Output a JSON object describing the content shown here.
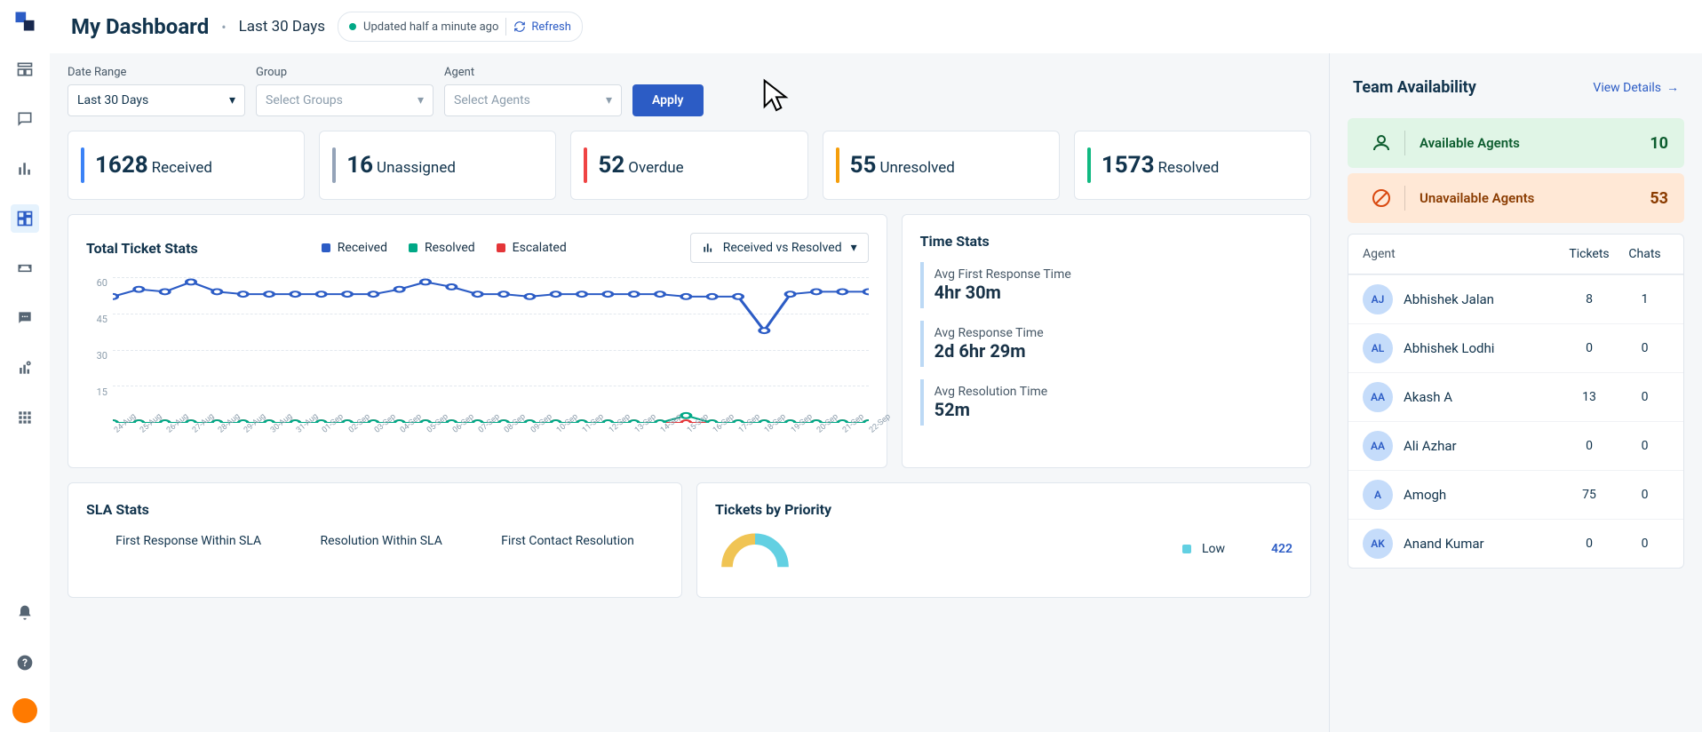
{
  "page": {
    "title": "My Dashboard",
    "date_range": "Last 30 Days",
    "status": "Updated half a minute ago",
    "refresh": "Refresh"
  },
  "filters": {
    "date": {
      "label": "Date Range",
      "value": "Last 30 Days"
    },
    "group": {
      "label": "Group",
      "placeholder": "Select Groups"
    },
    "agent": {
      "label": "Agent",
      "placeholder": "Select Agents"
    },
    "apply": "Apply"
  },
  "kpis": [
    {
      "value": "1628",
      "label": "Received",
      "color": "#3b82f6"
    },
    {
      "value": "16",
      "label": "Unassigned",
      "color": "#94a3b8"
    },
    {
      "value": "52",
      "label": "Overdue",
      "color": "#ef4444"
    },
    {
      "value": "55",
      "label": "Unresolved",
      "color": "#f59e0b"
    },
    {
      "value": "1573",
      "label": "Resolved",
      "color": "#10b981"
    }
  ],
  "ticket_stats": {
    "title": "Total Ticket Stats",
    "selector": "Received vs Resolved",
    "legend": [
      {
        "label": "Received",
        "color": "#2c5cc5"
      },
      {
        "label": "Resolved",
        "color": "#00a886"
      },
      {
        "label": "Escalated",
        "color": "#e43538"
      }
    ]
  },
  "chart_data": {
    "type": "line",
    "title": "Total Ticket Stats",
    "xlabel": "",
    "ylabel": "",
    "ylim": [
      0,
      60
    ],
    "y_ticks": [
      60,
      45,
      30,
      15,
      ""
    ],
    "categories": [
      "24-Aug",
      "25-Aug",
      "26-Aug",
      "27-Aug",
      "28-Aug",
      "29-Aug",
      "30-Aug",
      "31-Aug",
      "01-Sep",
      "02-Sep",
      "03-Sep",
      "04-Sep",
      "05-Sep",
      "06-Sep",
      "07-Sep",
      "08-Sep",
      "09-Sep",
      "10-Sep",
      "11-Sep",
      "12-Sep",
      "13-Sep",
      "14-Sep",
      "15-Sep",
      "16-Sep",
      "17-Sep",
      "18-Sep",
      "19-Sep",
      "20-Sep",
      "21-Sep",
      "22-Sep"
    ],
    "series": [
      {
        "name": "Received",
        "color": "#2c5cc5",
        "values": [
          52,
          55,
          54,
          58,
          54,
          53,
          53,
          53,
          53,
          53,
          53,
          55,
          58,
          56,
          53,
          53,
          52,
          53,
          53,
          53,
          53,
          53,
          52,
          52,
          52,
          38,
          53,
          54,
          54,
          54
        ]
      },
      {
        "name": "Resolved",
        "color": "#00a886",
        "values": [
          0,
          0,
          0,
          0,
          0,
          0,
          0,
          0,
          0,
          0,
          0,
          0,
          0,
          0,
          0,
          0,
          0,
          0,
          0,
          0,
          0,
          0,
          3,
          0,
          0,
          0,
          0,
          0,
          0,
          0
        ]
      },
      {
        "name": "Escalated",
        "color": "#e43538",
        "values": [
          0,
          0,
          0,
          0,
          0,
          0,
          0,
          0,
          0,
          0,
          0,
          0,
          0,
          0,
          0,
          0,
          0,
          0,
          0,
          0,
          0,
          0,
          0,
          0,
          0,
          0,
          0,
          0,
          0,
          0
        ]
      }
    ]
  },
  "time_stats": {
    "title": "Time Stats",
    "items": [
      {
        "label": "Avg First Response Time",
        "value": "4hr 30m"
      },
      {
        "label": "Avg Response Time",
        "value": "2d 6hr 29m"
      },
      {
        "label": "Avg Resolution Time",
        "value": "52m"
      }
    ]
  },
  "sla": {
    "title": "SLA Stats",
    "cols": [
      "First Response Within SLA",
      "Resolution Within SLA",
      "First Contact Resolution"
    ]
  },
  "priority": {
    "title": "Tickets by Priority",
    "items": [
      {
        "label": "Low",
        "value": "422",
        "color": "#62d0e2"
      }
    ]
  },
  "team": {
    "title": "Team Availability",
    "view_link": "View Details",
    "available": {
      "label": "Available Agents",
      "count": "10"
    },
    "unavailable": {
      "label": "Unavailable Agents",
      "count": "53"
    },
    "headers": {
      "agent": "Agent",
      "tickets": "Tickets",
      "chats": "Chats"
    },
    "agents": [
      {
        "initials": "AJ",
        "name": "Abhishek Jalan",
        "tickets": "8",
        "chats": "1"
      },
      {
        "initials": "AL",
        "name": "Abhishek Lodhi",
        "tickets": "0",
        "chats": "0"
      },
      {
        "initials": "AA",
        "name": "Akash A",
        "tickets": "13",
        "chats": "0"
      },
      {
        "initials": "AA",
        "name": "Ali Azhar",
        "tickets": "0",
        "chats": "0"
      },
      {
        "initials": "A",
        "name": "Amogh",
        "tickets": "75",
        "chats": "0"
      },
      {
        "initials": "AK",
        "name": "Anand Kumar",
        "tickets": "0",
        "chats": "0"
      }
    ]
  }
}
